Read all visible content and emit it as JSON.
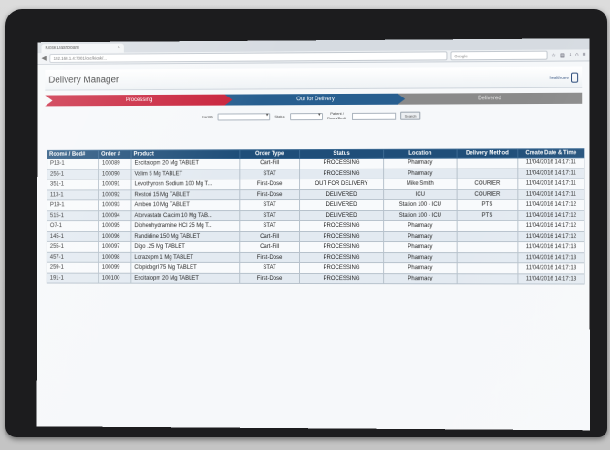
{
  "browser": {
    "tab_title": "Kiosk Dashboard",
    "url": "192.168.1.4:7001/csc/kiosk/...",
    "search_placeholder": "Google"
  },
  "app": {
    "title": "Delivery Manager",
    "logo_text": "healthcare"
  },
  "steps": [
    "Processing",
    "Out for Delivery",
    "Delivered"
  ],
  "filters": {
    "facility_label": "Facility",
    "status_label": "Status",
    "patient_label": "Patient / Room/Bed#",
    "search_button": "Search"
  },
  "table": {
    "columns": [
      "Room# / Bed#",
      "Order #",
      "Product",
      "Order Type",
      "Status",
      "Location",
      "Delivery Method",
      "Create Date & Time"
    ],
    "rows": [
      [
        "P13-1",
        "100089",
        "Escitalopm 20 Mg TABLET",
        "Cart-Fill",
        "PROCESSING",
        "Pharmacy",
        "",
        "11/04/2016 14:17:11"
      ],
      [
        "256-1",
        "100090",
        "Valim 5 Mg TABLET",
        "STAT",
        "PROCESSING",
        "Pharmacy",
        "",
        "11/04/2016 14:17:11"
      ],
      [
        "351-1",
        "100091",
        "Levothyrosn Sodium 100 Mg T...",
        "First-Dose",
        "OUT FOR DELIVERY",
        "Mike Smith",
        "COURIER",
        "11/04/2016 14:17:11"
      ],
      [
        "113-1",
        "100092",
        "Restori 15 Mg TABLET",
        "First-Dose",
        "DELIVERED",
        "ICU",
        "COURIER",
        "11/04/2016 14:17:11"
      ],
      [
        "P19-1",
        "100093",
        "Amben 10 Mg TABLET",
        "STAT",
        "DELIVERED",
        "Station 100 - ICU",
        "PTS",
        "11/04/2016 14:17:12"
      ],
      [
        "515-1",
        "100094",
        "Atorvastatn Calcim 10 Mg TAB...",
        "STAT",
        "DELIVERED",
        "Station 100 - ICU",
        "PTS",
        "11/04/2016 14:17:12"
      ],
      [
        "O7-1",
        "100095",
        "Diphenhydramine HCl 25 Mg T...",
        "STAT",
        "PROCESSING",
        "Pharmacy",
        "",
        "11/04/2016 14:17:12"
      ],
      [
        "145-1",
        "100096",
        "Randidine 150 Mg TABLET",
        "Cart-Fill",
        "PROCESSING",
        "Pharmacy",
        "",
        "11/04/2016 14:17:12"
      ],
      [
        "255-1",
        "100097",
        "Digo .25 Mg TABLET",
        "Cart-Fill",
        "PROCESSING",
        "Pharmacy",
        "",
        "11/04/2016 14:17:13"
      ],
      [
        "457-1",
        "100098",
        "Lorazepm 1 Mg TABLET",
        "First-Dose",
        "PROCESSING",
        "Pharmacy",
        "",
        "11/04/2016 14:17:13"
      ],
      [
        "259-1",
        "100099",
        "Clopidogrl 75 Mg TABLET",
        "STAT",
        "PROCESSING",
        "Pharmacy",
        "",
        "11/04/2016 14:17:13"
      ],
      [
        "191-1",
        "100100",
        "Escitalopm 20 Mg TABLET",
        "First-Dose",
        "PROCESSING",
        "Pharmacy",
        "",
        "11/04/2016 14:17:13"
      ]
    ]
  }
}
